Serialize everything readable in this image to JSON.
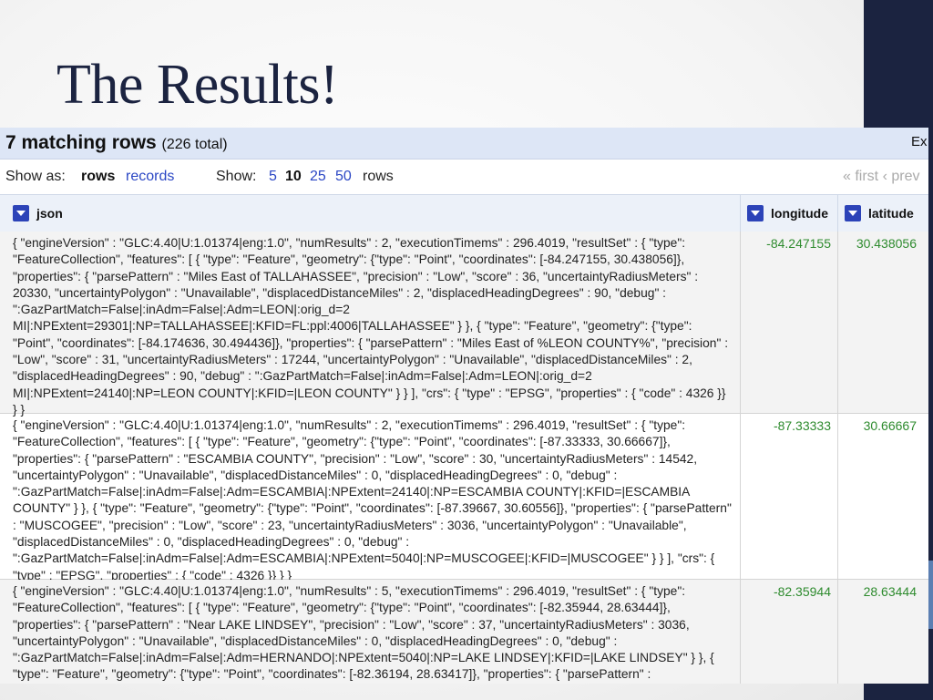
{
  "slide": {
    "title": "The Results!"
  },
  "results": {
    "count_label": "7 matching rows",
    "total_label": "(226 total)",
    "export_label": "Ex",
    "show_as_label": "Show as:",
    "view_rows": "rows",
    "view_records": "records",
    "show_label": "Show:",
    "page_sizes": [
      "5",
      "10",
      "25",
      "50"
    ],
    "rows_suffix": "rows",
    "pager_text": "« first ‹ prev"
  },
  "columns": {
    "json": "json",
    "longitude": "longitude",
    "latitude": "latitude"
  },
  "rows": [
    {
      "json": "{ \"engineVersion\" : \"GLC:4.40|U:1.01374|eng:1.0\", \"numResults\" : 2, \"executionTimems\" : 296.4019, \"resultSet\" : { \"type\": \"FeatureCollection\", \"features\": [ { \"type\": \"Feature\", \"geometry\": {\"type\": \"Point\", \"coordinates\": [-84.247155, 30.438056]}, \"properties\": { \"parsePattern\" : \"Miles East of TALLAHASSEE\", \"precision\" : \"Low\", \"score\" : 36, \"uncertaintyRadiusMeters\" : 20330, \"uncertaintyPolygon\" : \"Unavailable\", \"displacedDistanceMiles\" : 2, \"displacedHeadingDegrees\" : 90, \"debug\" : \":GazPartMatch=False|:inAdm=False|:Adm=LEON|:orig_d=2 MI|:NPExtent=29301|:NP=TALLAHASSEE|:KFID=FL:ppl:4006|TALLAHASSEE\" } }, { \"type\": \"Feature\", \"geometry\": {\"type\": \"Point\", \"coordinates\": [-84.174636, 30.494436]}, \"properties\": { \"parsePattern\" : \"Miles East of %LEON COUNTY%\", \"precision\" : \"Low\", \"score\" : 31, \"uncertaintyRadiusMeters\" : 17244, \"uncertaintyPolygon\" : \"Unavailable\", \"displacedDistanceMiles\" : 2, \"displacedHeadingDegrees\" : 90, \"debug\" : \":GazPartMatch=False|:inAdm=False|:Adm=LEON|:orig_d=2 MI|:NPExtent=24140|:NP=LEON COUNTY|:KFID=|LEON COUNTY\" } } ], \"crs\": { \"type\" : \"EPSG\", \"properties\" : { \"code\" : 4326 }} } }",
      "longitude": "-84.247155",
      "latitude": "30.438056"
    },
    {
      "json": "{ \"engineVersion\" : \"GLC:4.40|U:1.01374|eng:1.0\", \"numResults\" : 2, \"executionTimems\" : 296.4019, \"resultSet\" : { \"type\": \"FeatureCollection\", \"features\": [ { \"type\": \"Feature\", \"geometry\": {\"type\": \"Point\", \"coordinates\": [-87.33333, 30.66667]}, \"properties\": { \"parsePattern\" : \"ESCAMBIA COUNTY\", \"precision\" : \"Low\", \"score\" : 30, \"uncertaintyRadiusMeters\" : 14542, \"uncertaintyPolygon\" : \"Unavailable\", \"displacedDistanceMiles\" : 0, \"displacedHeadingDegrees\" : 0, \"debug\" : \":GazPartMatch=False|:inAdm=False|:Adm=ESCAMBIA|:NPExtent=24140|:NP=ESCAMBIA COUNTY|:KFID=|ESCAMBIA COUNTY\" } }, { \"type\": \"Feature\", \"geometry\": {\"type\": \"Point\", \"coordinates\": [-87.39667, 30.60556]}, \"properties\": { \"parsePattern\" : \"MUSCOGEE\", \"precision\" : \"Low\", \"score\" : 23, \"uncertaintyRadiusMeters\" : 3036, \"uncertaintyPolygon\" : \"Unavailable\", \"displacedDistanceMiles\" : 0, \"displacedHeadingDegrees\" : 0, \"debug\" : \":GazPartMatch=False|:inAdm=False|:Adm=ESCAMBIA|:NPExtent=5040|:NP=MUSCOGEE|:KFID=|MUSCOGEE\" } } ], \"crs\": { \"type\" : \"EPSG\", \"properties\" : { \"code\" : 4326 }} } }",
      "longitude": "-87.33333",
      "latitude": "30.66667"
    },
    {
      "json": "{ \"engineVersion\" : \"GLC:4.40|U:1.01374|eng:1.0\", \"numResults\" : 5, \"executionTimems\" : 296.4019, \"resultSet\" : { \"type\": \"FeatureCollection\", \"features\": [ { \"type\": \"Feature\", \"geometry\": {\"type\": \"Point\", \"coordinates\": [-82.35944, 28.63444]}, \"properties\": { \"parsePattern\" : \"Near LAKE LINDSEY\", \"precision\" : \"Low\", \"score\" : 37, \"uncertaintyRadiusMeters\" : 3036, \"uncertaintyPolygon\" : \"Unavailable\", \"displacedDistanceMiles\" : 0, \"displacedHeadingDegrees\" : 0, \"debug\" : \":GazPartMatch=False|:inAdm=False|:Adm=HERNANDO|:NPExtent=5040|:NP=LAKE LINDSEY|:KFID=|LAKE LINDSEY\" } }, { \"type\": \"Feature\", \"geometry\": {\"type\": \"Point\", \"coordinates\": [-82.36194, 28.63417]}, \"properties\": { \"parsePattern\" :",
      "longitude": "-82.35944",
      "latitude": "28.63444"
    }
  ],
  "colors": {
    "slide_title": "#1b2340",
    "right_bar": "#1b2340",
    "header_bar": "#dde6f6",
    "link": "#2a46c4",
    "number": "#2e8b2e"
  }
}
